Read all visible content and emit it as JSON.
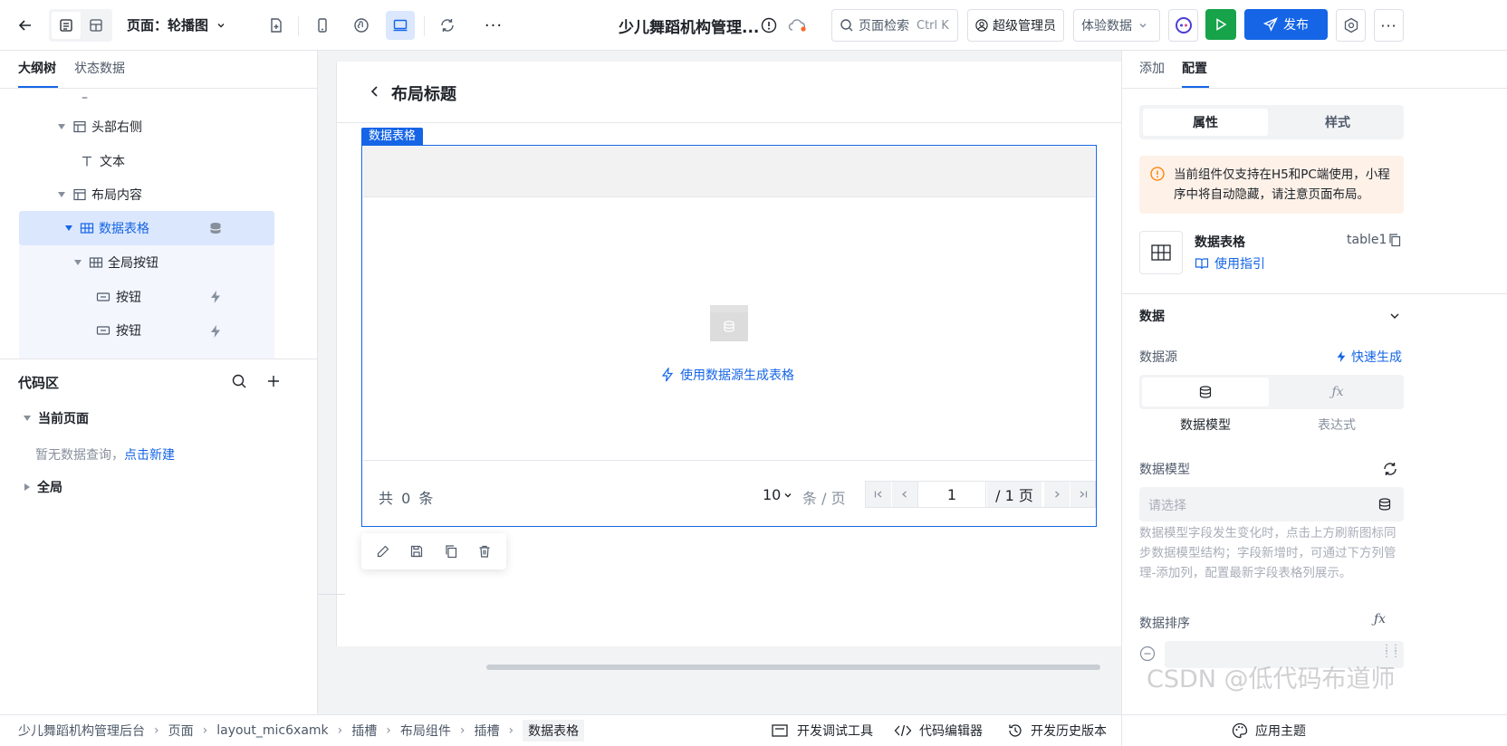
{
  "topbar": {
    "page_label": "页面：轮播图",
    "app_title": "少儿舞蹈机构管理...",
    "search_label": "页面检索",
    "search_shortcut": "Ctrl K",
    "user_label": "超级管理员",
    "data_env": "体验数据",
    "publish_label": "发布"
  },
  "left": {
    "tabs": [
      "大纲树",
      "状态数据"
    ],
    "tree": [
      {
        "label": "–"
      },
      {
        "label": "头部右侧"
      },
      {
        "label": "文本"
      },
      {
        "label": "布局内容"
      },
      {
        "label": "数据表格"
      },
      {
        "label": "全局按钮"
      },
      {
        "label": "按钮"
      },
      {
        "label": "按钮"
      }
    ],
    "code_area": {
      "title": "代码区",
      "current_page": "当前页面",
      "empty_text": "暂无数据查询，",
      "create_link": "点击新建",
      "global": "全局"
    }
  },
  "canvas": {
    "layout_title": "布局标题",
    "component_tag": "数据表格",
    "generate_text": "使用数据源生成表格",
    "pagination": {
      "total_prefix": "共",
      "total_count": "0",
      "total_suffix": "条",
      "page_size": "10",
      "page_size_unit": "条 / 页",
      "current_page": "1",
      "total_pages": "/ 1 页"
    }
  },
  "right": {
    "tabs": [
      "添加",
      "配置"
    ],
    "subtabs": [
      "属性",
      "样式"
    ],
    "warning": "当前组件仅支持在H5和PC端使用，小程序中将自动隐藏，请注意页面布局。",
    "component": {
      "name": "数据表格",
      "id": "table1",
      "guide_link": "使用指引"
    },
    "data_section": {
      "title": "数据",
      "source_label": "数据源",
      "quick_generate": "快速生成",
      "source_options": [
        "数据模型",
        "表达式"
      ],
      "model_label": "数据模型",
      "model_placeholder": "请选择",
      "help_text": "数据模型字段发生变化时，点击上方刷新图标同步数据模型结构；字段新增时，可通过下方列管理-添加列，配置最新字段表格列展示。",
      "sort_label": "数据排序"
    }
  },
  "statusbar": {
    "breadcrumbs": [
      "少儿舞蹈机构管理后台",
      "页面",
      "layout_mic6xamk",
      "插槽",
      "布局组件",
      "插槽",
      "数据表格"
    ],
    "debug_tool": "开发调试工具",
    "code_editor": "代码编辑器",
    "history": "开发历史版本",
    "theme": "应用主题"
  },
  "watermark": "CSDN @低代码布道师",
  "colors": {
    "primary": "#1565e6",
    "run_green": "#16a34a",
    "selected_bg": "#dbe7fd",
    "warning_bg": "#fdf1e8",
    "warning_icon": "#ff7d00"
  }
}
